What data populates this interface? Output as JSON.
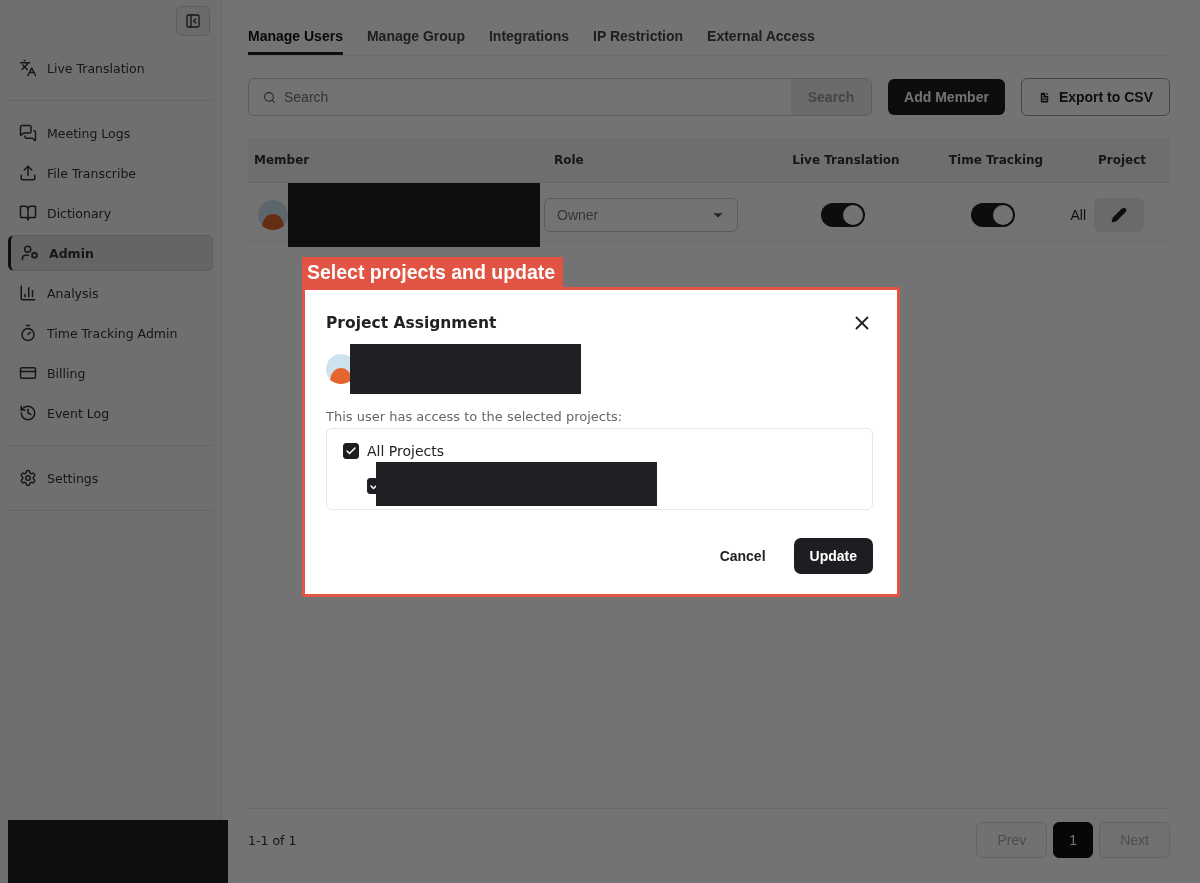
{
  "sidebar": {
    "sections": [
      {
        "items": [
          {
            "label": "Live Translation",
            "selected": false
          }
        ]
      },
      {
        "items": [
          {
            "label": "Meeting Logs",
            "selected": false
          },
          {
            "label": "File Transcribe",
            "selected": false
          },
          {
            "label": "Dictionary",
            "selected": false
          },
          {
            "label": "Admin",
            "selected": true
          },
          {
            "label": "Analysis",
            "selected": false
          },
          {
            "label": "Time Tracking Admin",
            "selected": false
          },
          {
            "label": "Billing",
            "selected": false
          },
          {
            "label": "Event Log",
            "selected": false
          }
        ]
      },
      {
        "items": [
          {
            "label": "Settings",
            "selected": false
          }
        ]
      }
    ]
  },
  "tabs": [
    {
      "label": "Manage Users",
      "selected": true
    },
    {
      "label": "Manage Group",
      "selected": false
    },
    {
      "label": "Integrations",
      "selected": false
    },
    {
      "label": "IP Restriction",
      "selected": false
    },
    {
      "label": "External Access",
      "selected": false
    }
  ],
  "search": {
    "placeholder": "Search",
    "button": "Search"
  },
  "actions": {
    "add": "Add Member",
    "export": "Export to CSV"
  },
  "table": {
    "columns": [
      "Member",
      "Role",
      "Live Translation",
      "Time Tracking",
      "Project"
    ],
    "rows": [
      {
        "role": "Owner",
        "live_translation": true,
        "time_tracking": true,
        "project": "All"
      }
    ]
  },
  "footer": {
    "range": "1-1 of 1",
    "prev": "Prev",
    "pages": [
      {
        "label": "1",
        "selected": true
      }
    ],
    "next": "Next"
  },
  "annotation": "Select projects and update",
  "dialog": {
    "title": "Project Assignment",
    "description": "This user has access to the selected projects:",
    "projects": [
      {
        "label": "All Projects",
        "checked": true,
        "children": [
          {
            "checked": true
          }
        ]
      }
    ],
    "cancel": "Cancel",
    "update": "Update"
  }
}
